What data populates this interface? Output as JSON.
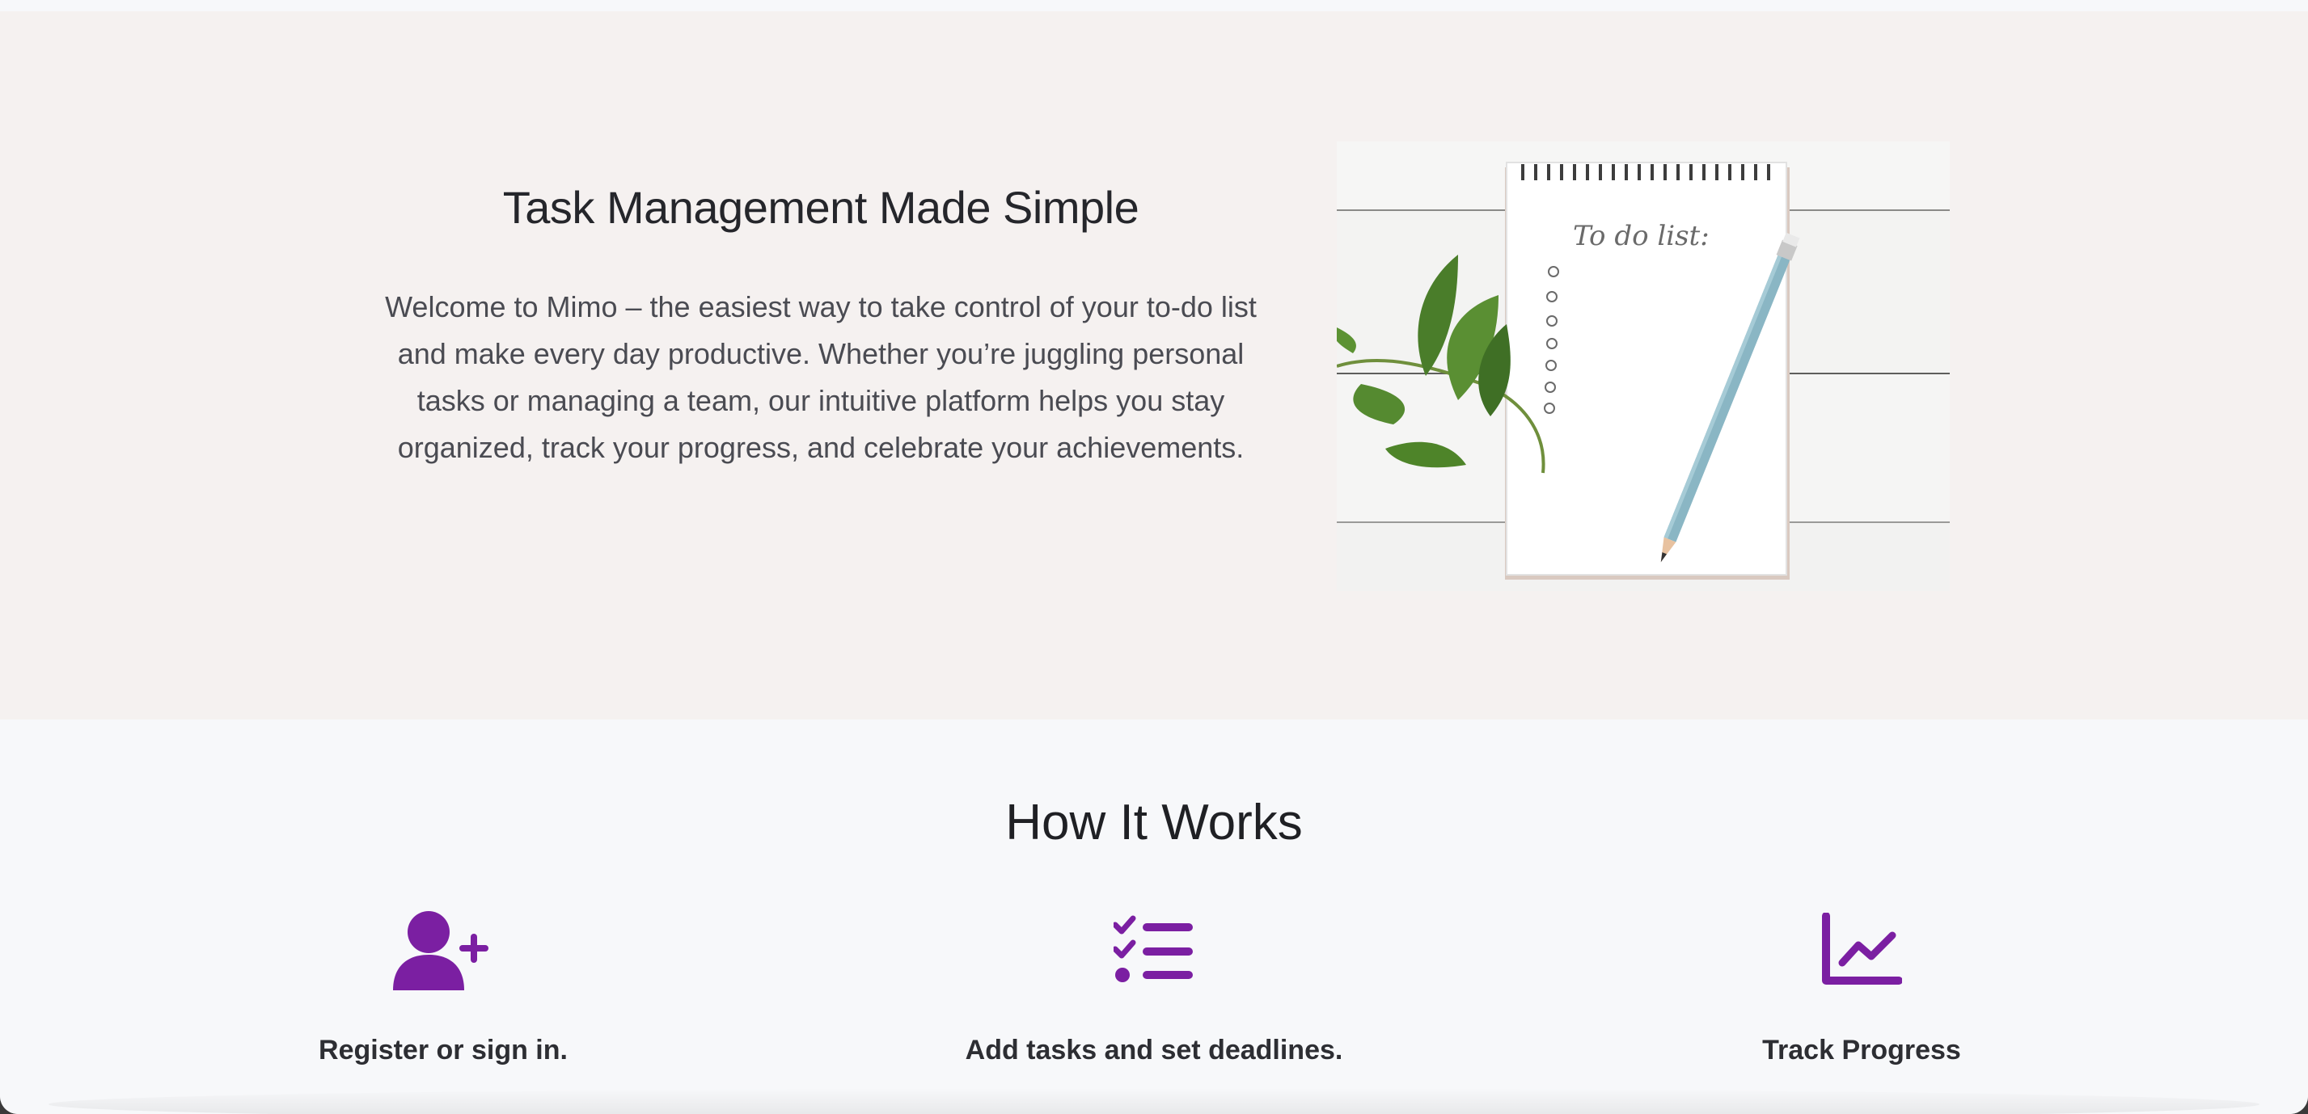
{
  "hero": {
    "title": "Task Management Made Simple",
    "body": "Welcome to Mimo – the easiest way to take control of your to-do list and make every day productive. Whether you’re juggling personal tasks or managing a team, our intuitive platform helps you stay organized, track your progress, and celebrate your achievements.",
    "image_caption": "To do list:"
  },
  "how_it_works": {
    "title": "How It Works",
    "steps": [
      {
        "label": "Register or sign in.",
        "icon": "user-plus-icon"
      },
      {
        "label": "Add tasks and set deadlines.",
        "icon": "checklist-icon"
      },
      {
        "label": "Track Progress",
        "icon": "chart-line-icon"
      }
    ]
  },
  "colors": {
    "accent": "#7b1fa2",
    "hero_background": "#f5f1f0",
    "page_background": "#f7f8fa"
  }
}
